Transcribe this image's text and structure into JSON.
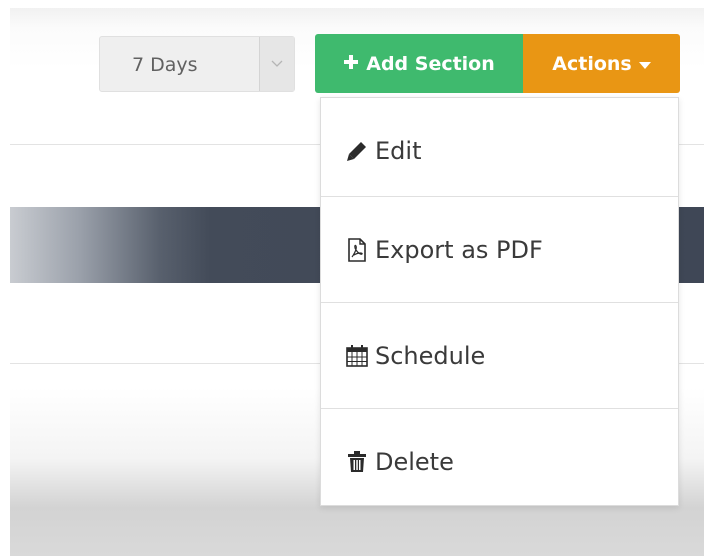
{
  "toolbar": {
    "date_range": {
      "selected": "7 Days"
    },
    "add_section_button": {
      "icon": "plus-icon",
      "label": "Add Section",
      "color": "#3fba6e"
    },
    "actions_button": {
      "label": "Actions",
      "icon": "caret-down-icon",
      "color": "#e99614"
    }
  },
  "actions_menu": {
    "items": [
      {
        "label": "Edit",
        "icon": "pencil-icon"
      },
      {
        "label": "Export as PDF",
        "icon": "pdf-file-icon"
      },
      {
        "label": "Schedule",
        "icon": "calendar-icon"
      },
      {
        "label": "Delete",
        "icon": "trash-icon"
      }
    ]
  },
  "colors": {
    "dark_band": "#3f4756",
    "menu_text": "#3a3a3a"
  }
}
